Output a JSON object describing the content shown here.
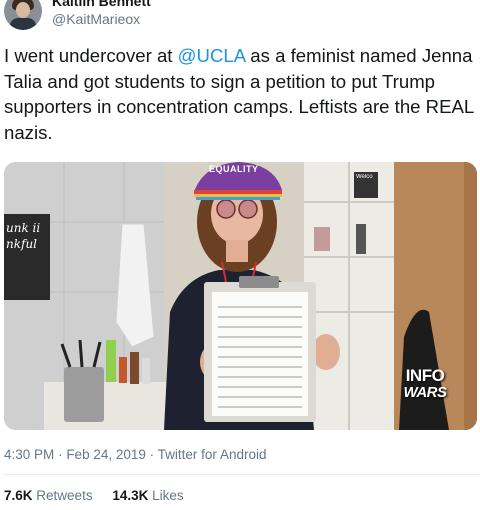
{
  "author": {
    "display_name": "Kaitlin Bennett",
    "handle": "@KaitMarieox"
  },
  "tweet": {
    "text_before": "I went undercover at ",
    "mention": "@UCLA",
    "text_after": " as a feminist named Jenna Talia and got students to sign a petition to put Trump supporters in concentration camps. Leftists are the REAL nazis."
  },
  "media": {
    "hat_text": "EQUALITY",
    "sign_text": "unk ii nkful",
    "watermark_top": "INFO",
    "watermark_bottom": "WARS",
    "right_sign_text": "Welco"
  },
  "meta": {
    "time": "4:30 PM",
    "separator": "·",
    "date": "Feb 24, 2019",
    "source": "Twitter for Android"
  },
  "stats": {
    "retweets_count": "7.6K",
    "retweets_label": "Retweets",
    "likes_count": "14.3K",
    "likes_label": "Likes"
  }
}
